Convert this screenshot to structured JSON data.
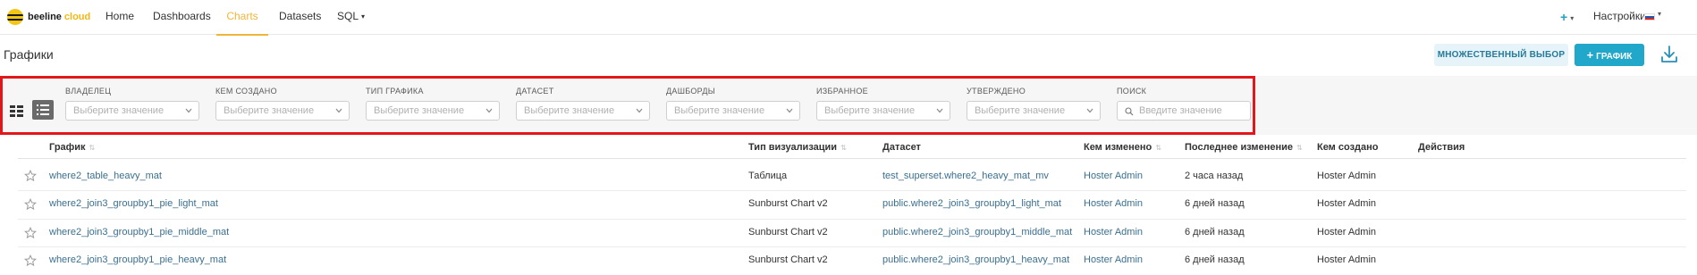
{
  "nav": {
    "logo_word1": "beeline",
    "logo_word2": "cloud",
    "links": [
      {
        "label": "Home",
        "active": false
      },
      {
        "label": "Dashboards",
        "active": false
      },
      {
        "label": "Charts",
        "active": true
      },
      {
        "label": "Datasets",
        "active": false
      },
      {
        "label": "SQL",
        "active": false
      }
    ],
    "settings_label": "Настройки",
    "plus_label": "+",
    "accent_color": "#f0b63b"
  },
  "page": {
    "title": "Графики",
    "multi_select_label": "МНОЖЕСТВЕННЫЙ ВЫБОР",
    "add_chart_label": "ГРАФИК",
    "add_chart_icon": "plus-icon",
    "download_icon": "download-icon",
    "primary_color": "#20a7c9",
    "highlight_color": "#e2161b"
  },
  "filters": [
    {
      "label": "ВЛАДЕЛЕЦ",
      "placeholder": "Выберите значение"
    },
    {
      "label": "КЕМ СОЗДАНО",
      "placeholder": "Выберите значение"
    },
    {
      "label": "ТИП ГРАФИКА",
      "placeholder": "Выберите значение"
    },
    {
      "label": "ДАТАСЕТ",
      "placeholder": "Выберите значение"
    },
    {
      "label": "ДАШБОРДЫ",
      "placeholder": "Выберите значение"
    },
    {
      "label": "ИЗБРАННОЕ",
      "placeholder": "Выберите значение"
    },
    {
      "label": "УТВЕРЖДЕНО",
      "placeholder": "Выберите значение"
    }
  ],
  "search": {
    "label": "ПОИСК",
    "placeholder": "Введите значение"
  },
  "table": {
    "headers": [
      "График",
      "Тип визуализации",
      "Датасет",
      "Кем изменено",
      "Последнее изменение",
      "Кем создано",
      "Действия"
    ],
    "rows": [
      {
        "name": "where2_table_heavy_mat",
        "viz": "Таблица",
        "dataset": "test_superset.where2_heavy_mat_mv",
        "modified_by": "Hoster Admin",
        "modified": "2 часа назад",
        "created_by": "Hoster Admin"
      },
      {
        "name": "where2_join3_groupby1_pie_light_mat",
        "viz": "Sunburst Chart v2",
        "dataset": "public.where2_join3_groupby1_light_mat",
        "modified_by": "Hoster Admin",
        "modified": "6 дней назад",
        "created_by": "Hoster Admin"
      },
      {
        "name": "where2_join3_groupby1_pie_middle_mat",
        "viz": "Sunburst Chart v2",
        "dataset": "public.where2_join3_groupby1_middle_mat",
        "modified_by": "Hoster Admin",
        "modified": "6 дней назад",
        "created_by": "Hoster Admin"
      },
      {
        "name": "where2_join3_groupby1_pie_heavy_mat",
        "viz": "Sunburst Chart v2",
        "dataset": "public.where2_join3_groupby1_heavy_mat",
        "modified_by": "Hoster Admin",
        "modified": "6 дней назад",
        "created_by": "Hoster Admin"
      }
    ]
  }
}
